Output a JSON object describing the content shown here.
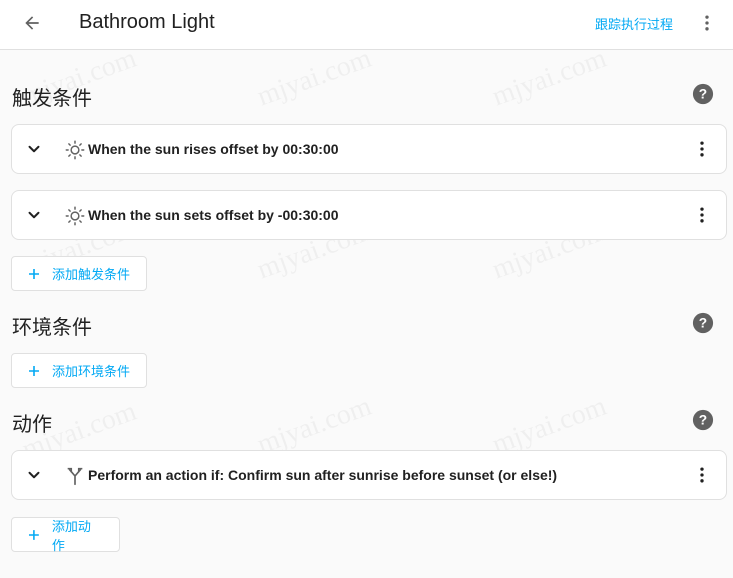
{
  "header": {
    "title": "Bathroom Light",
    "trace_label": "跟踪执行过程"
  },
  "sections": {
    "triggers": {
      "title": "触发条件",
      "items": [
        {
          "text": "When the sun rises offset by 00:30:00",
          "icon": "sun-icon"
        },
        {
          "text": "When the sun sets offset by -00:30:00",
          "icon": "sun-icon"
        }
      ],
      "add_label": "添加触发条件"
    },
    "conditions": {
      "title": "环境条件",
      "add_label": "添加环境条件"
    },
    "actions": {
      "title": "动作",
      "items": [
        {
          "text": "Perform an action if: Confirm sun after sunrise before sunset (or else!)",
          "icon": "branch-icon"
        }
      ],
      "add_label": "添加动作"
    }
  },
  "watermark": "mjyai.com",
  "colors": {
    "accent": "#03a9f4",
    "help_icon": "#616161",
    "background": "#fafafa"
  }
}
